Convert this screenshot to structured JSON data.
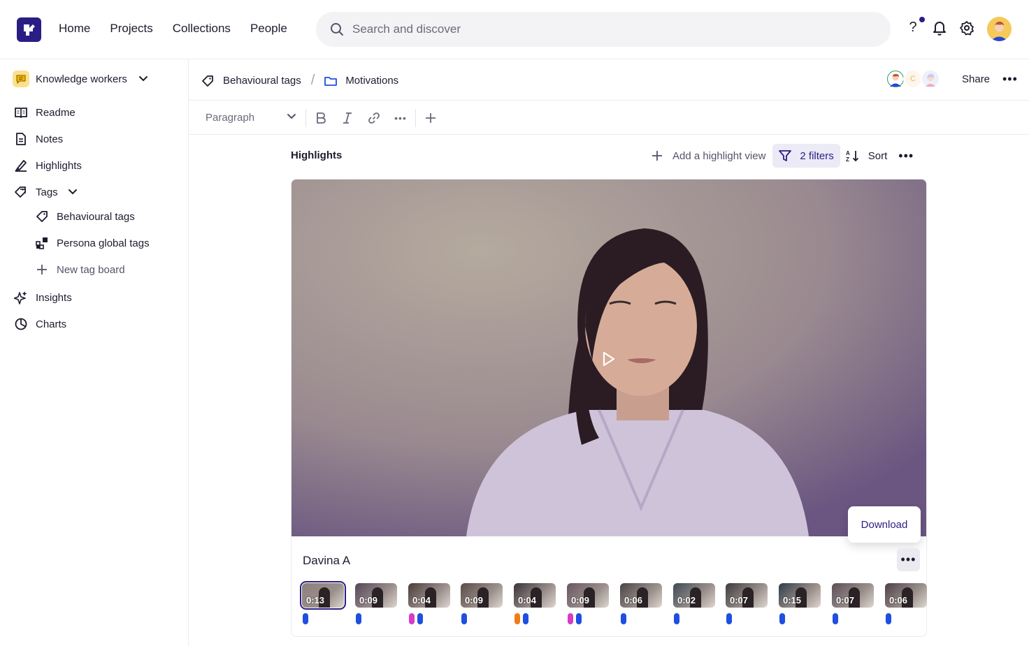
{
  "nav": {
    "links": [
      "Home",
      "Projects",
      "Collections",
      "People"
    ]
  },
  "search": {
    "placeholder": "Search and discover"
  },
  "topbar": {
    "help": "?"
  },
  "sidebar": {
    "workspace": "Knowledge workers",
    "items": [
      {
        "label": "Readme",
        "icon": "book-icon"
      },
      {
        "label": "Notes",
        "icon": "note-icon"
      },
      {
        "label": "Highlights",
        "icon": "highlighter-icon"
      },
      {
        "label": "Tags",
        "icon": "tag-icon"
      },
      {
        "label": "Behavioural tags",
        "icon": "tag-outline-icon"
      },
      {
        "label": "Persona global tags",
        "icon": "persona-tags-icon"
      },
      {
        "label": "New tag board",
        "icon": "plus-icon"
      },
      {
        "label": "Insights",
        "icon": "sparkle-icon"
      },
      {
        "label": "Charts",
        "icon": "pie-chart-icon"
      }
    ]
  },
  "breadcrumb": {
    "tag_board": "Behavioural tags",
    "folder": "Motivations",
    "separator": "/"
  },
  "header": {
    "share": "Share",
    "collaborator_initial": "C"
  },
  "toolbar": {
    "block_type": "Paragraph"
  },
  "highlights": {
    "title": "Highlights",
    "add_view": "Add a highlight view",
    "filters": "2 filters",
    "sort": "Sort",
    "download": "Download",
    "person": "Davina A",
    "clips": [
      {
        "duration": "0:13",
        "selected": true,
        "tags": [
          "#1f4fe0"
        ]
      },
      {
        "duration": "0:09",
        "tags": [
          "#1f4fe0"
        ]
      },
      {
        "duration": "0:04",
        "tags": [
          "#d63cc6",
          "#1f4fe0"
        ]
      },
      {
        "duration": "0:09",
        "tags": [
          "#1f4fe0"
        ]
      },
      {
        "duration": "0:04",
        "tags": [
          "#f07a1a",
          "#1f4fe0"
        ]
      },
      {
        "duration": "0:09",
        "tags": [
          "#d63cc6",
          "#1f4fe0"
        ]
      },
      {
        "duration": "0:06",
        "tags": [
          "#1f4fe0"
        ]
      },
      {
        "duration": "0:02",
        "tags": [
          "#1f4fe0"
        ]
      },
      {
        "duration": "0:07",
        "tags": [
          "#1f4fe0"
        ]
      },
      {
        "duration": "0:15",
        "tags": [
          "#1f4fe0"
        ]
      },
      {
        "duration": "0:07",
        "tags": [
          "#1f4fe0"
        ]
      },
      {
        "duration": "0:06",
        "tags": [
          "#1f4fe0"
        ]
      }
    ]
  },
  "colors": {
    "brand": "#2a1e84",
    "tag_blue": "#1f4fe0",
    "tag_pink": "#d63cc6",
    "tag_orange": "#f07a1a"
  }
}
